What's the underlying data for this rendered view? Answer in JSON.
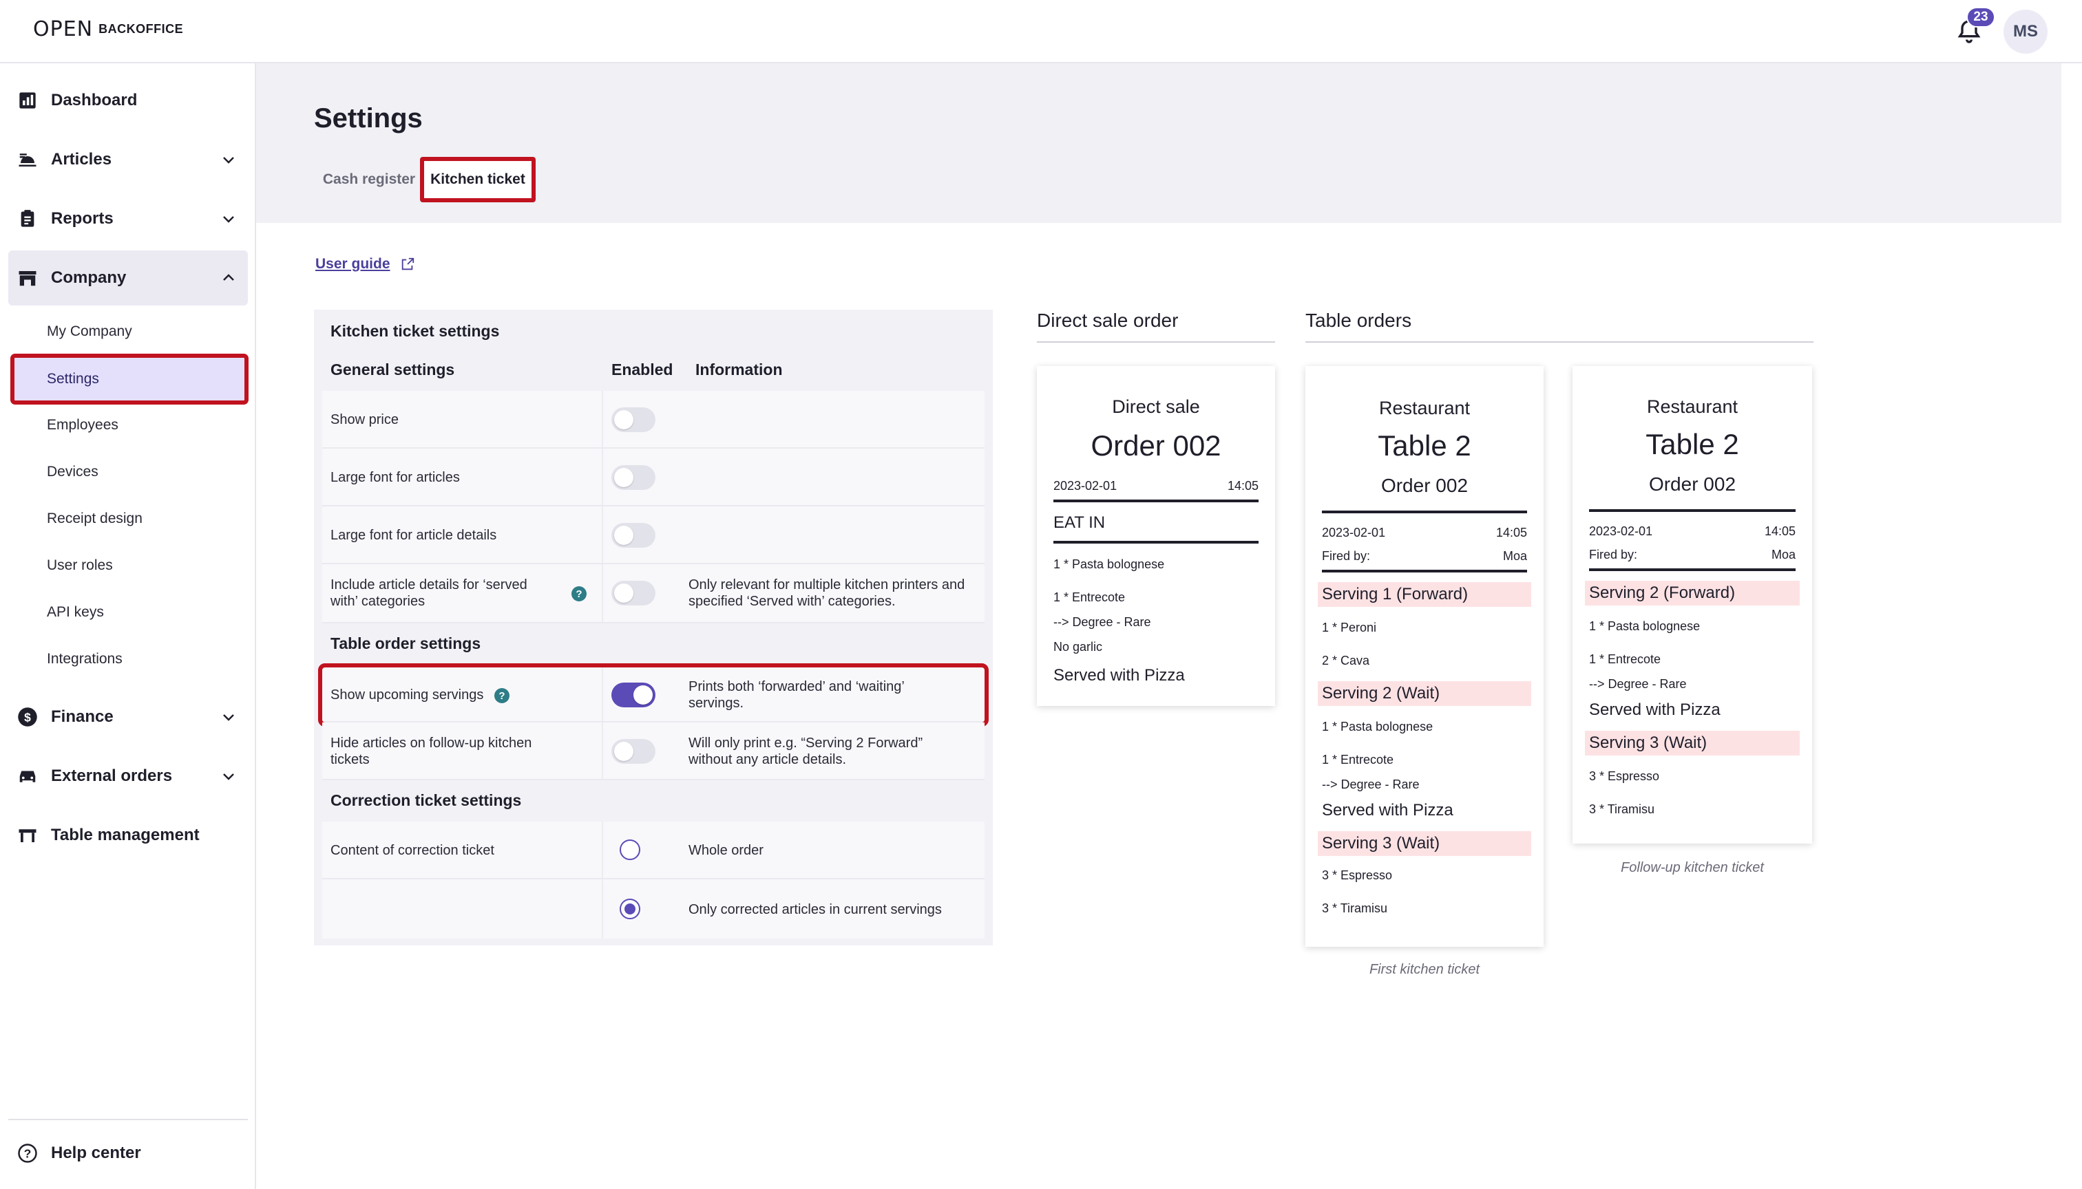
{
  "app": {
    "logo_mark": "OPEN",
    "logo_text": "BACKOFFICE",
    "notifications": "23",
    "avatar": "MS"
  },
  "sidebar": {
    "items": [
      {
        "label": "Dashboard"
      },
      {
        "label": "Articles"
      },
      {
        "label": "Reports"
      },
      {
        "label": "Company"
      },
      {
        "label": "Finance"
      },
      {
        "label": "External orders"
      },
      {
        "label": "Table management"
      }
    ],
    "company_sub": [
      "My Company",
      "Settings",
      "Employees",
      "Devices",
      "Receipt design",
      "User roles",
      "API keys",
      "Integrations"
    ],
    "help": "Help center"
  },
  "page": {
    "title": "Settings",
    "tabs": [
      "Cash register",
      "Kitchen ticket"
    ],
    "user_guide": "User guide"
  },
  "settings": {
    "title": "Kitchen ticket settings",
    "general": "General settings",
    "col_enabled": "Enabled",
    "col_info": "Information",
    "show_price": "Show price",
    "large_font_articles": "Large font for articles",
    "large_font_details": "Large font for article details",
    "include_details": "Include article details for ‘served with’ categories",
    "include_details_info": "Only relevant for multiple kitchen printers and specified ‘Served with’ categories.",
    "table_order": "Table order settings",
    "show_upcoming": "Show upcoming servings",
    "show_upcoming_info": "Prints both ‘forwarded’ and ‘waiting’ servings.",
    "hide_articles": "Hide articles on follow-up kitchen tickets",
    "hide_articles_info": "Will only print e.g. “Serving 2 Forward” without any article details.",
    "correction": "Correction ticket settings",
    "content_correction": "Content of correction ticket",
    "whole_order": "Whole order",
    "only_corrected": "Only corrected articles in current servings"
  },
  "previews": {
    "direct_heading": "Direct sale order",
    "table_heading": "Table orders",
    "direct": {
      "title": "Direct sale",
      "order": "Order 002",
      "date": "2023-02-01",
      "time": "14:05",
      "eat_in": "EAT IN",
      "l1": "1 * Pasta bolognese",
      "l2": "1 * Entrecote",
      "l3": "--> Degree - Rare",
      "l4": "No garlic",
      "served": "Served with Pizza"
    },
    "first": {
      "restaurant": "Restaurant",
      "table": "Table 2",
      "order": "Order 002",
      "date": "2023-02-01",
      "time": "14:05",
      "fired_by": "Fired by:",
      "fired_name": "Moa",
      "s1": "Serving 1 (Forward)",
      "a1": "1 * Peroni",
      "a2": "2 * Cava",
      "s2": "Serving 2 (Wait)",
      "a3": "1 * Pasta bolognese",
      "a4": "1 * Entrecote",
      "a5": "--> Degree - Rare",
      "served": "Served with Pizza",
      "s3": "Serving 3 (Wait)",
      "a6": "3 * Espresso",
      "a7": "3 * Tiramisu",
      "caption": "First kitchen ticket"
    },
    "followup": {
      "restaurant": "Restaurant",
      "table": "Table 2",
      "order": "Order 002",
      "date": "2023-02-01",
      "time": "14:05",
      "fired_by": "Fired by:",
      "fired_name": "Moa",
      "s2": "Serving 2 (Forward)",
      "a1": "1 * Pasta bolognese",
      "a2": "1 * Entrecote",
      "a3": "--> Degree - Rare",
      "served": "Served with Pizza",
      "s3": "Serving 3 (Wait)",
      "a4": "3 * Espresso",
      "a5": "3 * Tiramisu",
      "caption": "Follow-up kitchen ticket"
    }
  },
  "colors": {
    "accent": "#5b4bb7",
    "highlight": "#c1121f",
    "serving_bg": "#fde2e4"
  }
}
